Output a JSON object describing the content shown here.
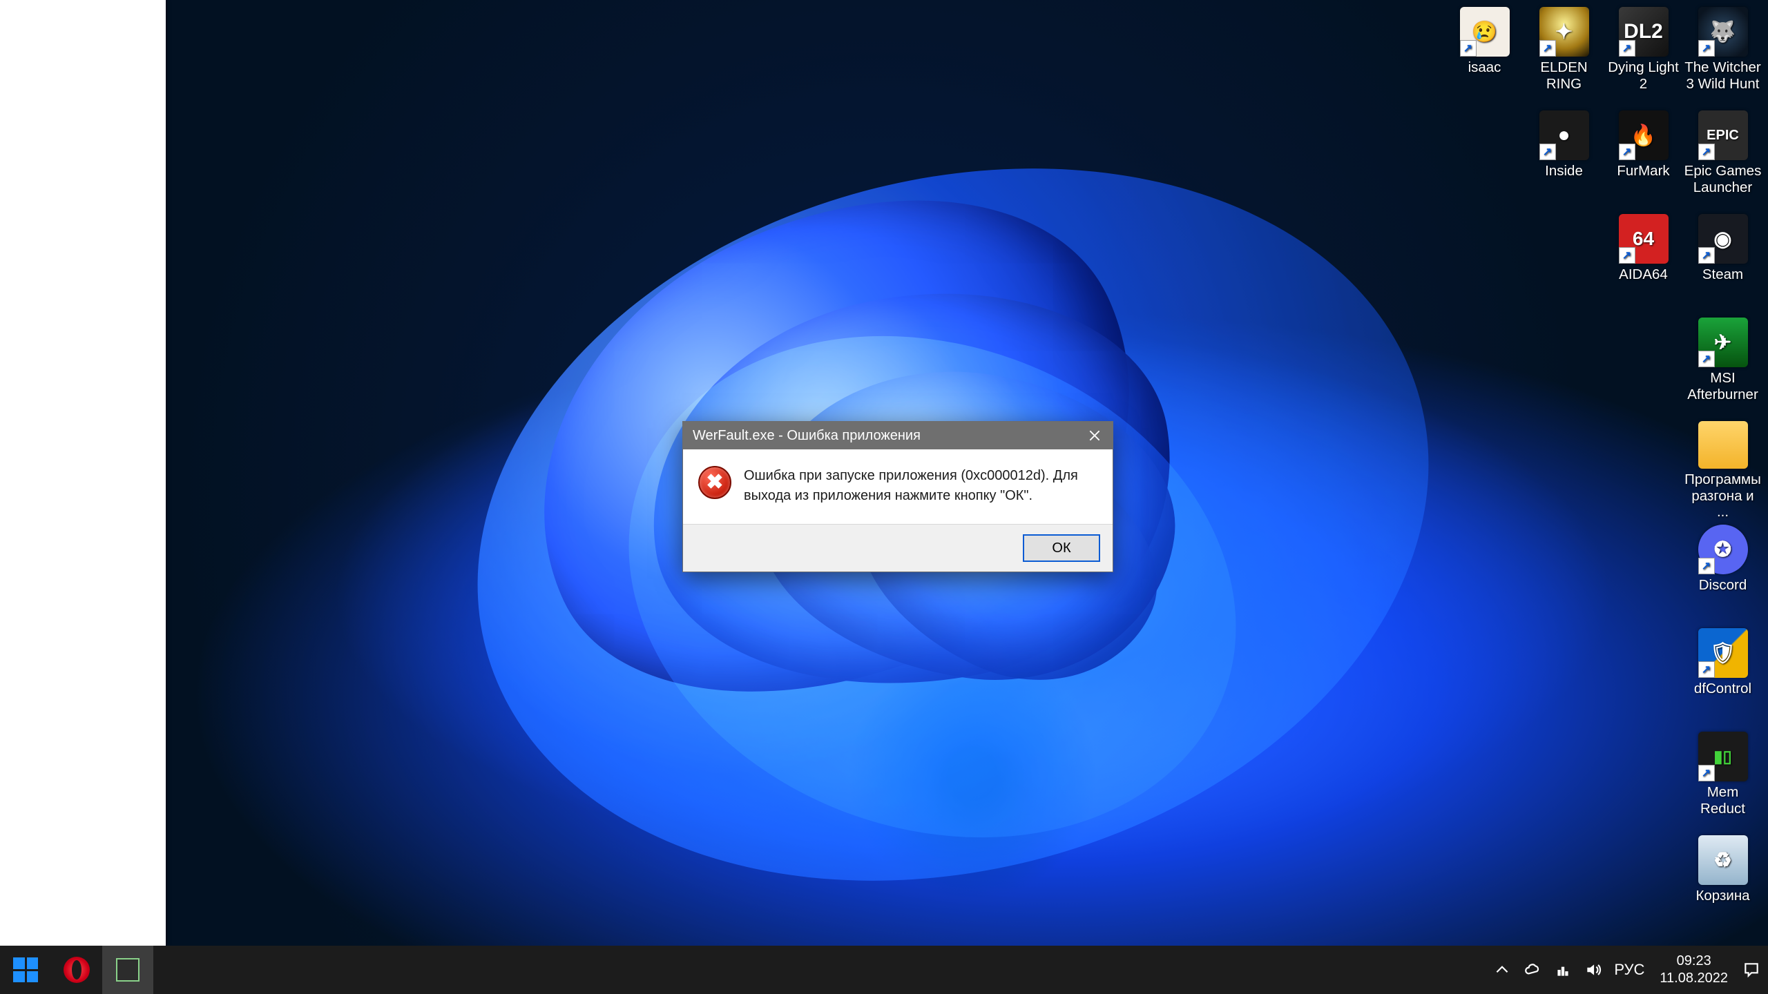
{
  "desktop_icons": {
    "row1": [
      "isaac",
      "ELDEN RING",
      "Dying Light 2",
      "The Witcher 3 Wild Hunt"
    ],
    "row2_col2": "Inside",
    "row2_col3": "FurMark",
    "row2_col4": "Epic Games Launcher",
    "row3_col3": "AIDA64",
    "row3_col4": "Steam",
    "row4_col4": "MSI Afterburner",
    "row5_col4": "Программы разгона и ...",
    "row6_col4": "Discord",
    "row7_col4": "dfControl",
    "row8_col4": "Mem Reduct",
    "row9_col4": "Корзина"
  },
  "icon_glyphs": {
    "isaac": "😢",
    "elden": "✦",
    "dl2": "DL2",
    "witcher": "🐺",
    "inside": "●",
    "furmark": "🔥",
    "epic": "EPIC",
    "aida": "64",
    "steam": "◉",
    "msi": "✈",
    "folder": "",
    "discord": "✪",
    "dfcontrol": "🛡",
    "memreduct": "▮▯",
    "recycle": "♻"
  },
  "dialog": {
    "title": "WerFault.exe - Ошибка приложения",
    "message": "Ошибка при запуске приложения (0xc000012d). Для выхода из приложения нажмите кнопку \"ОК\".",
    "ok_label": "ОК",
    "error_glyph": "✖"
  },
  "taskbar": {
    "lang": "РУС",
    "time": "09:23",
    "date": "11.08.2022"
  }
}
